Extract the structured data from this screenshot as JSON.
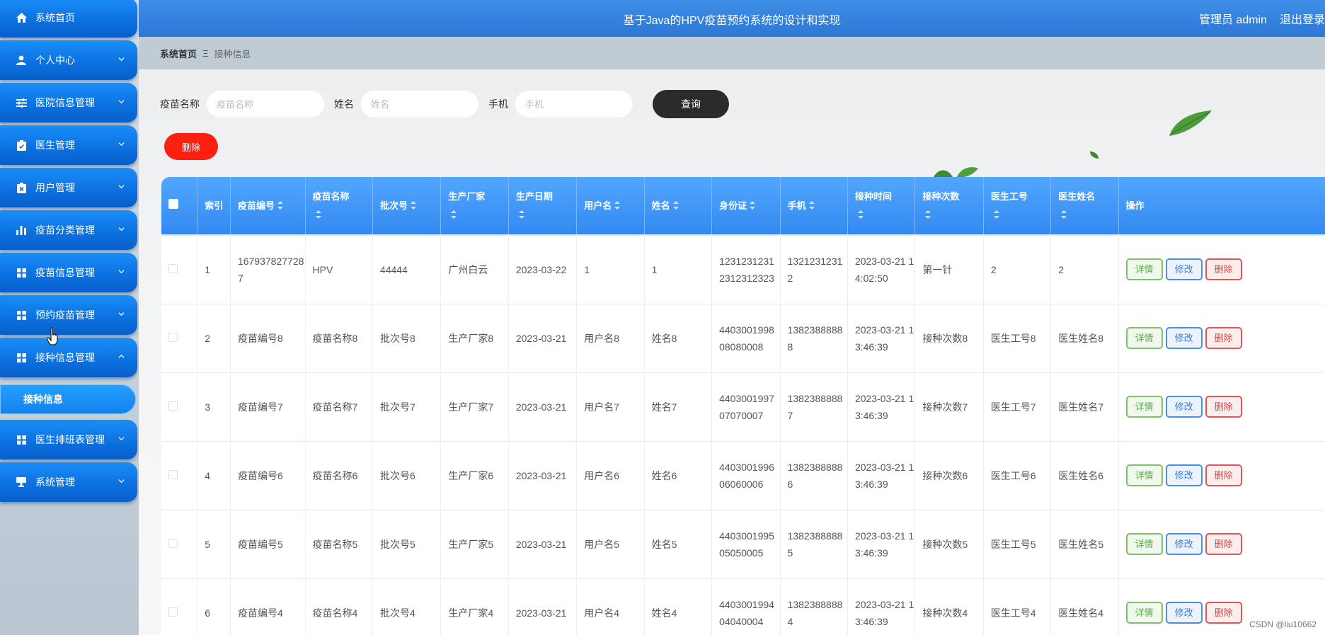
{
  "header": {
    "title": "基于Java的HPV疫苗预约系统的设计和实现",
    "user": "管理员 admin",
    "logout": "退出登录"
  },
  "sidebar": {
    "items": [
      {
        "label": "系统首页",
        "icon": "home-icon",
        "arrow": false
      },
      {
        "label": "个人中心",
        "icon": "user-icon",
        "arrow": "down"
      },
      {
        "label": "医院信息管理",
        "icon": "sliders-icon",
        "arrow": "down"
      },
      {
        "label": "医生管理",
        "icon": "clipboard-icon",
        "arrow": "down"
      },
      {
        "label": "用户管理",
        "icon": "clipboard-x-icon",
        "arrow": "down"
      },
      {
        "label": "疫苗分类管理",
        "icon": "bar-chart-icon",
        "arrow": "down"
      },
      {
        "label": "疫苗信息管理",
        "icon": "grid-icon",
        "arrow": "down"
      },
      {
        "label": "预约疫苗管理",
        "icon": "grid-icon",
        "arrow": "down"
      },
      {
        "label": "接种信息管理",
        "icon": "grid-icon",
        "arrow": "up"
      },
      {
        "label": "医生排班表管理",
        "icon": "grid-icon",
        "arrow": "down"
      },
      {
        "label": "系统管理",
        "icon": "monitor-icon",
        "arrow": "down"
      }
    ],
    "submenu": {
      "label": "接种信息"
    }
  },
  "breadcrumb": {
    "home": "系统首页",
    "separator": "Ξ",
    "current": "接种信息"
  },
  "search": {
    "vaccine_label": "疫苗名称",
    "vaccine_placeholder": "疫苗名称",
    "name_label": "姓名",
    "name_placeholder": "姓名",
    "phone_label": "手机",
    "phone_placeholder": "手机",
    "search_button": "查询"
  },
  "actions": {
    "delete_button": "删除"
  },
  "table": {
    "columns": [
      {
        "label": "",
        "sortable": false
      },
      {
        "label": "索引",
        "sortable": false
      },
      {
        "label": "疫苗编号",
        "sortable": true
      },
      {
        "label": "疫苗名称",
        "sortable": true
      },
      {
        "label": "批次号",
        "sortable": true
      },
      {
        "label": "生产厂家",
        "sortable": true
      },
      {
        "label": "生产日期",
        "sortable": true
      },
      {
        "label": "用户名",
        "sortable": true
      },
      {
        "label": "姓名",
        "sortable": true
      },
      {
        "label": "身份证",
        "sortable": true
      },
      {
        "label": "手机",
        "sortable": true
      },
      {
        "label": "接种时间",
        "sortable": true
      },
      {
        "label": "接种次数",
        "sortable": true
      },
      {
        "label": "医生工号",
        "sortable": true
      },
      {
        "label": "医生姓名",
        "sortable": true
      },
      {
        "label": "操作",
        "sortable": false
      }
    ],
    "rows": [
      {
        "index": "1",
        "vaccine_no": "1679378277287",
        "vaccine_name": "HPV",
        "batch": "44444",
        "maker": "广州白云",
        "prod_date": "2023-03-22",
        "username": "1",
        "name": "1",
        "id_card": "12312312312312312323",
        "phone": "13212312312",
        "time": "2023-03-21 14:02:50",
        "count": "第一针",
        "doc_no": "2",
        "doc_name": "2"
      },
      {
        "index": "2",
        "vaccine_no": "疫苗编号8",
        "vaccine_name": "疫苗名称8",
        "batch": "批次号8",
        "maker": "生产厂家8",
        "prod_date": "2023-03-21",
        "username": "用户名8",
        "name": "姓名8",
        "id_card": "440300199808080008",
        "phone": "13823888888",
        "time": "2023-03-21 13:46:39",
        "count": "接种次数8",
        "doc_no": "医生工号8",
        "doc_name": "医生姓名8"
      },
      {
        "index": "3",
        "vaccine_no": "疫苗编号7",
        "vaccine_name": "疫苗名称7",
        "batch": "批次号7",
        "maker": "生产厂家7",
        "prod_date": "2023-03-21",
        "username": "用户名7",
        "name": "姓名7",
        "id_card": "440300199707070007",
        "phone": "13823888887",
        "time": "2023-03-21 13:46:39",
        "count": "接种次数7",
        "doc_no": "医生工号7",
        "doc_name": "医生姓名7"
      },
      {
        "index": "4",
        "vaccine_no": "疫苗编号6",
        "vaccine_name": "疫苗名称6",
        "batch": "批次号6",
        "maker": "生产厂家6",
        "prod_date": "2023-03-21",
        "username": "用户名6",
        "name": "姓名6",
        "id_card": "440300199606060006",
        "phone": "13823888886",
        "time": "2023-03-21 13:46:39",
        "count": "接种次数6",
        "doc_no": "医生工号6",
        "doc_name": "医生姓名6"
      },
      {
        "index": "5",
        "vaccine_no": "疫苗编号5",
        "vaccine_name": "疫苗名称5",
        "batch": "批次号5",
        "maker": "生产厂家5",
        "prod_date": "2023-03-21",
        "username": "用户名5",
        "name": "姓名5",
        "id_card": "440300199505050005",
        "phone": "13823888885",
        "time": "2023-03-21 13:46:39",
        "count": "接种次数5",
        "doc_no": "医生工号5",
        "doc_name": "医生姓名5"
      },
      {
        "index": "6",
        "vaccine_no": "疫苗编号4",
        "vaccine_name": "疫苗名称4",
        "batch": "批次号4",
        "maker": "生产厂家4",
        "prod_date": "2023-03-21",
        "username": "用户名4",
        "name": "姓名4",
        "id_card": "440300199404040004",
        "phone": "13823888884",
        "time": "2023-03-21 13:46:39",
        "count": "接种次数4",
        "doc_no": "医生工号4",
        "doc_name": "医生姓名4"
      }
    ],
    "row_actions": {
      "detail": "详情",
      "edit": "修改",
      "delete": "删除"
    }
  },
  "watermark": "CSDN @liu10662",
  "colors": {
    "accent": "#2b77d6",
    "sidebar": "#0b6fe0",
    "delete": "#ff1f0f",
    "search_button": "#2b2b2b"
  }
}
